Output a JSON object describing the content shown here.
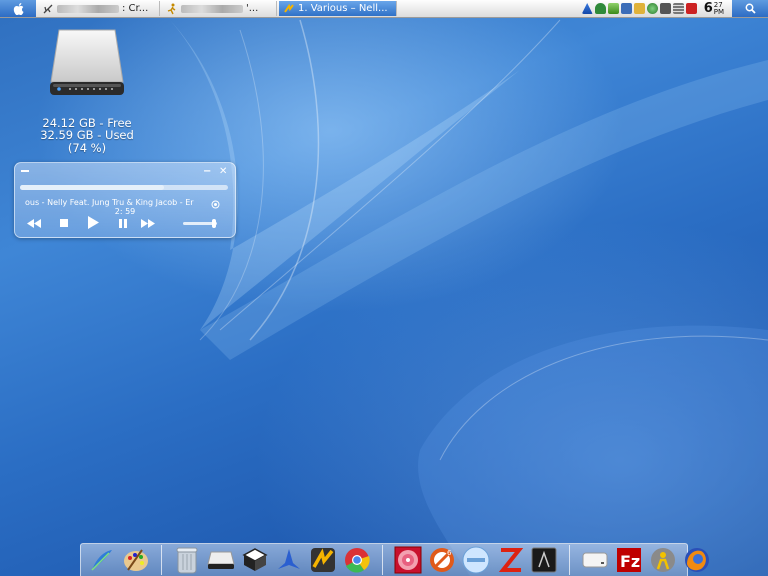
{
  "topbar": {
    "tasks": [
      {
        "label": ": Cr..."
      },
      {
        "label": "'..."
      },
      {
        "label": "1. Various – Nell..."
      }
    ],
    "clock": {
      "hour": "6",
      "minute": "27",
      "ampm": "PM"
    }
  },
  "drive": {
    "free": "24.12 GB - Free",
    "used": "32.59 GB - Used",
    "percent": "(74 %)"
  },
  "player": {
    "track": "ous - Nelly Feat. Jung Tru & King Jacob - Er",
    "time": "2: 59",
    "progress": 0.69,
    "volume": 0.9
  },
  "dock": {
    "items": [
      "feather-icon",
      "paint-palette-icon",
      "trash-icon",
      "harddisk-icon",
      "stack-box-icon",
      "azureus-icon",
      "winamp-icon",
      "chrome-icon",
      "cd-burn-icon",
      "recycle-app-icon",
      "wmp-icon",
      "zip-icon",
      "terminal-icon",
      "drive-mini-icon",
      "filezilla-icon",
      "user-icon",
      "firefox-icon"
    ]
  }
}
